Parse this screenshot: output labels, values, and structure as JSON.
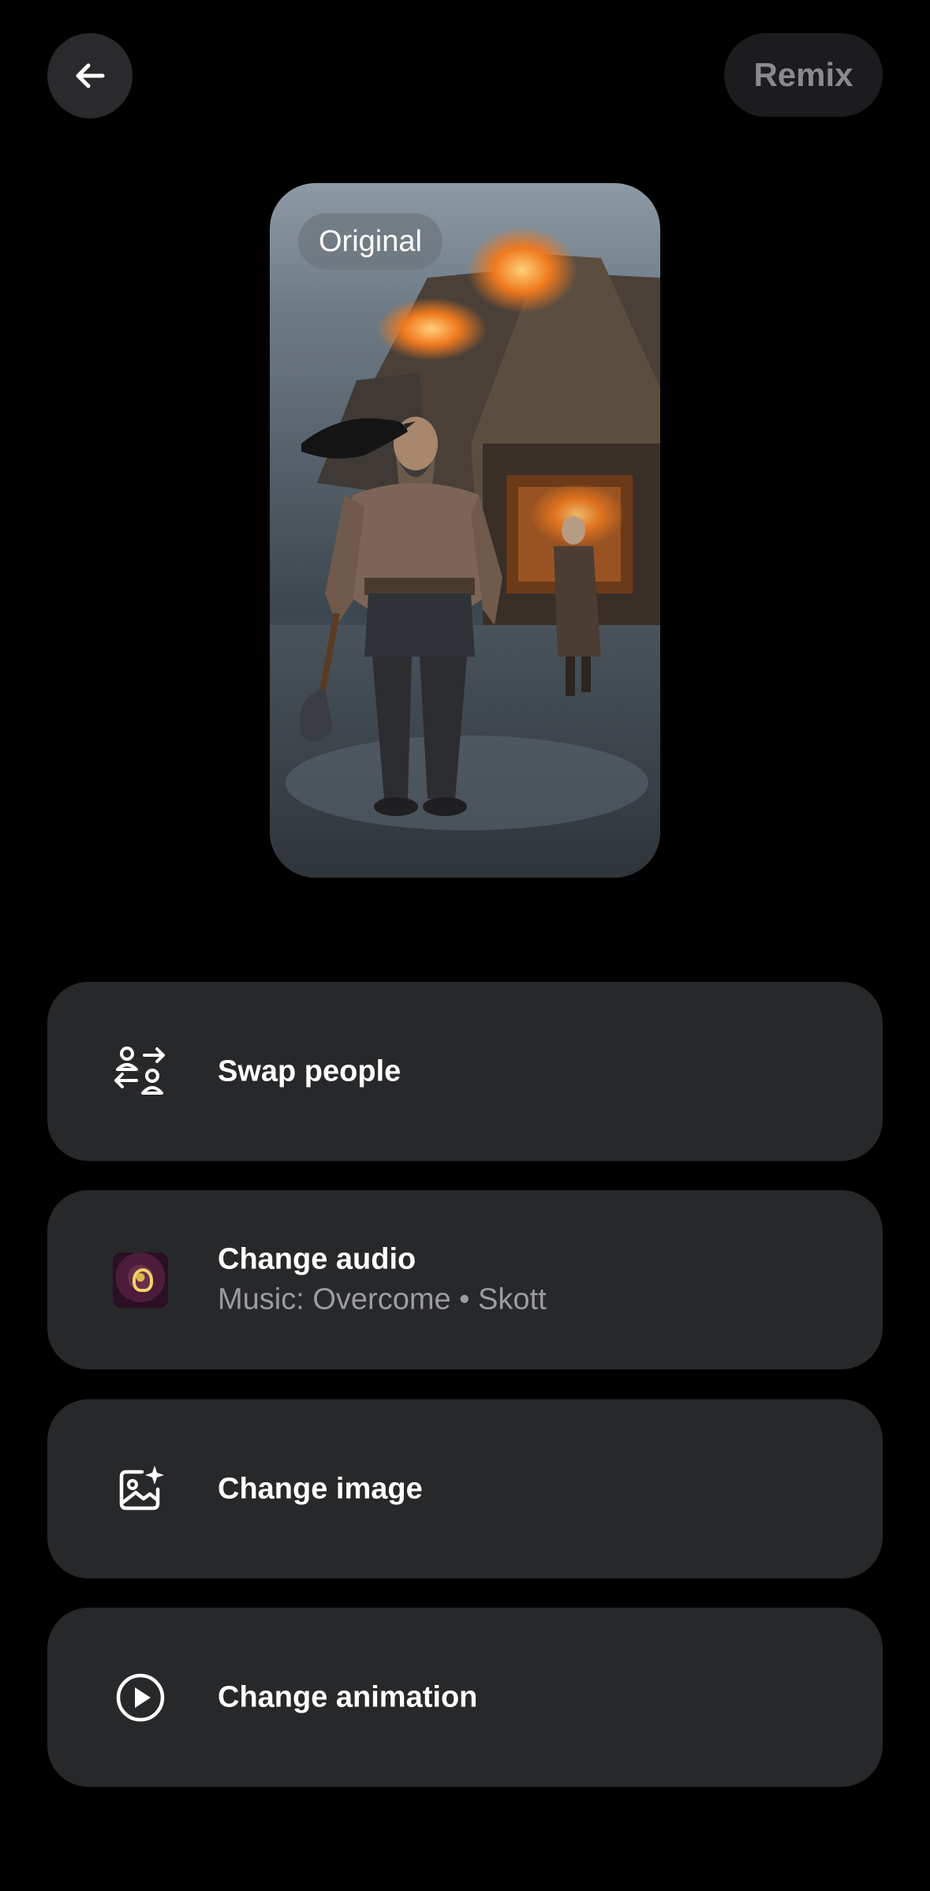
{
  "header": {
    "back_icon": "arrow-left-icon",
    "remix_label": "Remix"
  },
  "preview": {
    "badge_label": "Original",
    "image_subject": "viking-warrior-burning-village"
  },
  "options": [
    {
      "label": "Swap people",
      "icon": "swap-people-icon"
    },
    {
      "label": "Change audio",
      "sub": "Music: Overcome • Skott",
      "icon": "album-art"
    },
    {
      "label": "Change image",
      "icon": "image-sparkle-icon"
    },
    {
      "label": "Change animation",
      "icon": "play-circle-icon"
    }
  ],
  "colors": {
    "background": "#000000",
    "card": "#27282a",
    "back_button": "#2a2a2c",
    "remix_button": "#1c1c1e",
    "remix_text": "#8a8a8e",
    "subtext": "#9b9ca0"
  }
}
